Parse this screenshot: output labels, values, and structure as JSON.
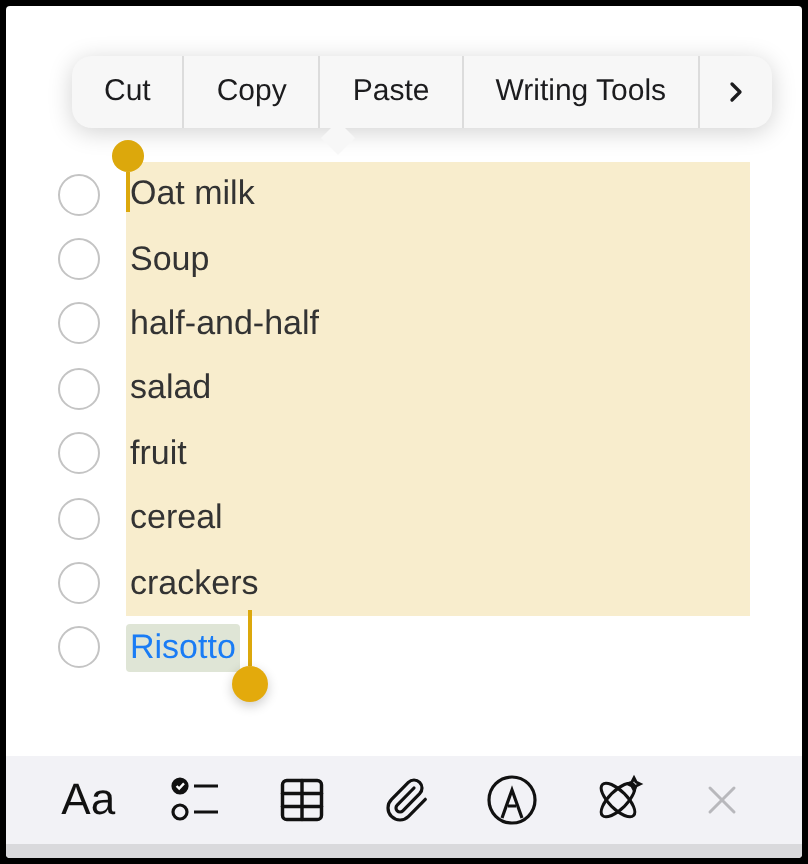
{
  "edit_menu": {
    "items": [
      "Cut",
      "Copy",
      "Paste",
      "Writing Tools"
    ]
  },
  "checklist": [
    {
      "text": "Oat milk",
      "checked": false,
      "highlighted": true,
      "selected": false
    },
    {
      "text": "Soup",
      "checked": false,
      "highlighted": true,
      "selected": false
    },
    {
      "text": "half-and-half",
      "checked": false,
      "highlighted": true,
      "selected": false
    },
    {
      "text": "salad",
      "checked": false,
      "highlighted": true,
      "selected": false
    },
    {
      "text": "fruit",
      "checked": false,
      "highlighted": true,
      "selected": false
    },
    {
      "text": "cereal",
      "checked": false,
      "highlighted": true,
      "selected": false
    },
    {
      "text": "crackers",
      "checked": false,
      "highlighted": true,
      "selected": false
    },
    {
      "text": "Risotto",
      "checked": false,
      "highlighted": false,
      "selected": true
    }
  ],
  "toolbar": {
    "format_label": "Aa",
    "close_disabled": true
  }
}
